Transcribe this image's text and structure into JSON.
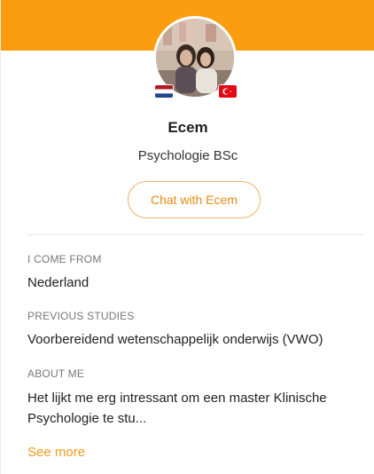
{
  "profile": {
    "name": "Ecem",
    "program": "Psychologie BSc",
    "chat_label": "Chat with Ecem",
    "flags": [
      "netherlands-flag",
      "turkey-flag"
    ]
  },
  "details": {
    "come_from_label": "I COME FROM",
    "come_from_value": "Nederland",
    "previous_studies_label": "PREVIOUS STUDIES",
    "previous_studies_value": "Voorbereidend wetenschappelijk onderwijs (VWO)",
    "about_label": "ABOUT ME",
    "about_value": "Het lijkt me erg intressant om een master Klinische Psychologie te stu...",
    "see_more": "See more"
  },
  "colors": {
    "banner": "#fb9d0e",
    "accent": "#e88a12"
  }
}
